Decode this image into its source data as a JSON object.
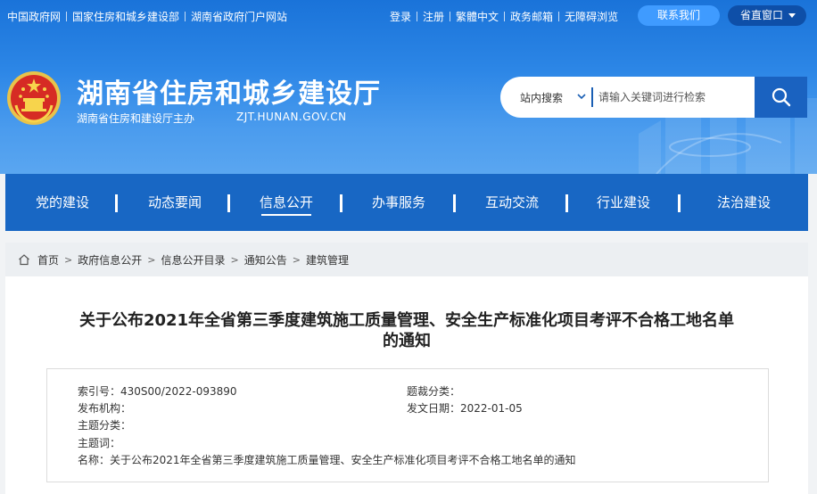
{
  "topbar": {
    "left_links": [
      "中国政府网",
      "国家住房和城乡建设部",
      "湖南省政府门户网站"
    ],
    "right_links": [
      "登录",
      "注册",
      "繁體中文",
      "政务邮箱",
      "无障碍浏览"
    ],
    "contact_label": "联系我们",
    "province_label": "省直窗口"
  },
  "site": {
    "title": "湖南省住房和城乡建设厅",
    "subtitle": "湖南省住房和建设厅主办",
    "domain": "ZJT.HUNAN.GOV.CN"
  },
  "search": {
    "scope_label": "站内搜索",
    "placeholder": "请输入关键词进行检索"
  },
  "nav": {
    "items": [
      "党的建设",
      "动态要闻",
      "信息公开",
      "办事服务",
      "互动交流",
      "行业建设",
      "法治建设"
    ],
    "active": "信息公开"
  },
  "breadcrumb": {
    "items": [
      "首页",
      "政府信息公开",
      "信息公开目录",
      "通知公告",
      "建筑管理"
    ]
  },
  "document": {
    "title_line1": "关于公布2021年全省第三季度建筑施工质量管理、安全生产标准化项目考评不合格工地名单",
    "title_line2": "的通知",
    "meta": {
      "index_label": "索引号：",
      "index_value": "430S00/2022-093890",
      "category_label": "题裁分类：",
      "category_value": "",
      "publisher_label": "发布机构：",
      "publisher_value": "",
      "date_label": "发文日期：",
      "date_value": "2022-01-05",
      "topic_label": "主题分类：",
      "topic_value": "",
      "keywords_label": "主题词：",
      "keywords_value": "",
      "name_label": "名称：",
      "name_value": "关于公布2021年全省第三季度建筑施工质量管理、安全生产标准化项目考评不合格工地名单的通知"
    }
  },
  "colors": {
    "header_blue": "#1a73d9",
    "nav_blue": "#1867c4",
    "contact_button": "#3f9bff",
    "province_button": "#0e4fa8"
  },
  "icons": [
    "national-emblem-icon",
    "chevron-down-icon",
    "search-icon",
    "home-icon"
  ]
}
